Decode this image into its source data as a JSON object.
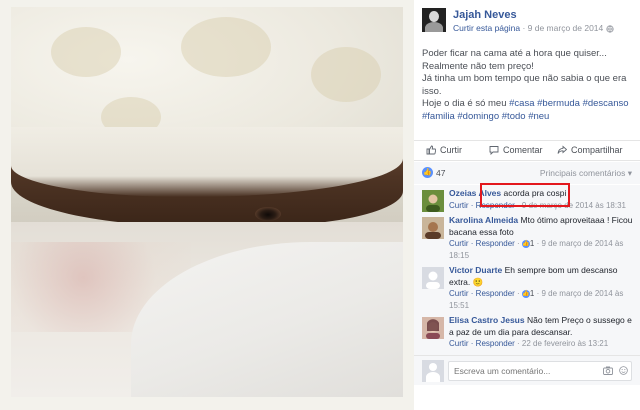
{
  "post": {
    "author_name": "Jajah Neves",
    "follow_link": "Curtir esta página",
    "meta_separator": " · ",
    "date": "9 de março de 2014",
    "visibility_icon": "globe-icon",
    "text_lines": [
      "Poder ficar na cama até a hora que quiser...",
      "Realmente não tem preço!",
      "Já tinha um bom tempo que não sabia o que era isso.",
      "Hoje o dia é só meu"
    ],
    "hashtags": [
      "#casa",
      "#bermuda",
      "#descanso",
      "#familia",
      "#domingo",
      "#todo",
      "#neu"
    ]
  },
  "actions": {
    "like": "Curtir",
    "comment": "Comentar",
    "share": "Compartilhar"
  },
  "stats": {
    "like_count": "47",
    "sort_label": "Principais comentários",
    "sort_icon": "chevron-down-icon"
  },
  "comments": [
    {
      "name": "Ozeias Alves",
      "text": "acorda pra cospi",
      "reply_label": "Curtir · Responder",
      "likes": "",
      "date": "9 de março de 2014 às 18:31",
      "avatar_color": "#6b8e3d"
    },
    {
      "name": "Karolina Almeida",
      "text": "Mto ótimo aproveitaaa ! Ficou bacana essa foto",
      "reply_label": "Curtir · Responder",
      "likes": "1",
      "date": "9 de março de 2014 às 18:15",
      "avatar_color": "#a5754f"
    },
    {
      "name": "Victor Duarte",
      "text": "Eh sempre bom um descanso extra. 🙂",
      "reply_label": "Curtir · Responder",
      "likes": "1",
      "date": "9 de março de 2014 às 15:51",
      "avatar_color": "#7d8fa6"
    },
    {
      "name": "Elisa Castro Jesus",
      "text": "Não tem Preço o sussego e a paz de um dia para descansar.",
      "reply_label": "Curtir · Responder",
      "likes": "",
      "date": "22 de fevereiro às 13:21",
      "avatar_color": "#8b4a55"
    }
  ],
  "composer": {
    "placeholder": "Escreva um comentário...",
    "camera_icon": "camera-icon",
    "emoji_icon": "smiley-icon"
  },
  "annotation": {
    "color": "#e3181d"
  }
}
